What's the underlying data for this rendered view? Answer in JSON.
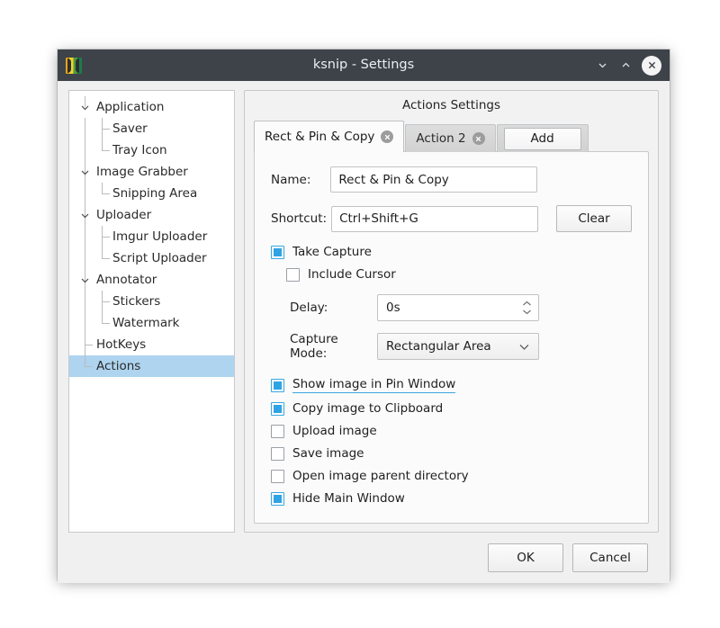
{
  "window": {
    "title": "ksnip - Settings",
    "app_icon": "ksnip-icon",
    "controls": {
      "minimize": "minimize-icon",
      "maximize": "maximize-icon",
      "close": "close-icon"
    }
  },
  "sidebar": {
    "items": [
      {
        "label": "Application",
        "level": 0,
        "selected": false
      },
      {
        "label": "Saver",
        "level": 1,
        "selected": false
      },
      {
        "label": "Tray Icon",
        "level": 1,
        "selected": false
      },
      {
        "label": "Image Grabber",
        "level": 0,
        "selected": false
      },
      {
        "label": "Snipping Area",
        "level": 1,
        "selected": false
      },
      {
        "label": "Uploader",
        "level": 0,
        "selected": false
      },
      {
        "label": "Imgur Uploader",
        "level": 1,
        "selected": false
      },
      {
        "label": "Script Uploader",
        "level": 1,
        "selected": false
      },
      {
        "label": "Annotator",
        "level": 0,
        "selected": false
      },
      {
        "label": "Stickers",
        "level": 1,
        "selected": false
      },
      {
        "label": "Watermark",
        "level": 1,
        "selected": false
      },
      {
        "label": "HotKeys",
        "level": 0,
        "selected": false
      },
      {
        "label": "Actions",
        "level": 0,
        "selected": true
      }
    ]
  },
  "panel": {
    "title": "Actions Settings",
    "tabs": [
      {
        "label": "Rect & Pin & Copy",
        "active": true
      },
      {
        "label": "Action 2",
        "active": false
      }
    ],
    "add_label": "Add",
    "form": {
      "name_label": "Name:",
      "name_value": "Rect & Pin & Copy",
      "shortcut_label": "Shortcut:",
      "shortcut_value": "Ctrl+Shift+G",
      "clear_label": "Clear",
      "take_capture_label": "Take Capture",
      "include_cursor_label": "Include Cursor",
      "delay_label": "Delay:",
      "delay_value": "0s",
      "capture_mode_label": "Capture Mode:",
      "capture_mode_value": "Rectangular Area"
    },
    "options": [
      {
        "label": "Show image in Pin Window",
        "checked": true,
        "focused": true
      },
      {
        "label": "Copy image to Clipboard",
        "checked": true,
        "focused": false
      },
      {
        "label": "Upload image",
        "checked": false,
        "focused": false
      },
      {
        "label": "Save image",
        "checked": false,
        "focused": false
      },
      {
        "label": "Open image parent directory",
        "checked": false,
        "focused": false
      },
      {
        "label": "Hide Main Window",
        "checked": true,
        "focused": false
      }
    ]
  },
  "footer": {
    "ok_label": "OK",
    "cancel_label": "Cancel"
  },
  "colors": {
    "titlebar": "#3d4349",
    "accent_checkbox": "#2fa3e3",
    "selection": "#aed4ef",
    "window_bg": "#f0f0f0"
  }
}
